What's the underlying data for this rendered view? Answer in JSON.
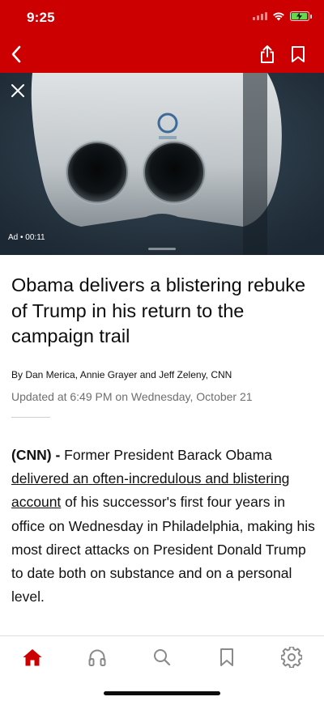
{
  "status_bar": {
    "time": "9:25"
  },
  "header": {
    "color": "#cc0000",
    "back_icon": "chevron-left-icon",
    "share_icon": "share-icon",
    "bookmark_icon": "bookmark-icon"
  },
  "video": {
    "ad_label": "Ad • 00:11",
    "close_icon": "close-icon"
  },
  "article": {
    "headline": "Obama delivers a blistering rebuke of Trump in his return to the campaign trail",
    "byline": "By Dan Merica, Annie Grayer and Jeff Zeleny, CNN",
    "updated": "Updated at 6:49 PM on Wednesday, October 21",
    "body": {
      "source": "(CNN)",
      "dash": " - ",
      "intro": "Former President Barack Obama ",
      "link_text": "delivered an often-incredulous and blistering account",
      "rest": " of his successor's first four years in office on Wednesday in Philadelphia, making his most direct attacks on President Donald Trump to date both on substance and on a personal level."
    }
  },
  "tabbar": {
    "active_color": "#cc0000",
    "inactive_color": "#8a8a8a",
    "tabs": [
      {
        "icon": "home-icon",
        "active": true
      },
      {
        "icon": "headphones-icon",
        "active": false
      },
      {
        "icon": "search-icon",
        "active": false
      },
      {
        "icon": "bookmark-icon",
        "active": false
      },
      {
        "icon": "settings-icon",
        "active": false
      }
    ]
  }
}
